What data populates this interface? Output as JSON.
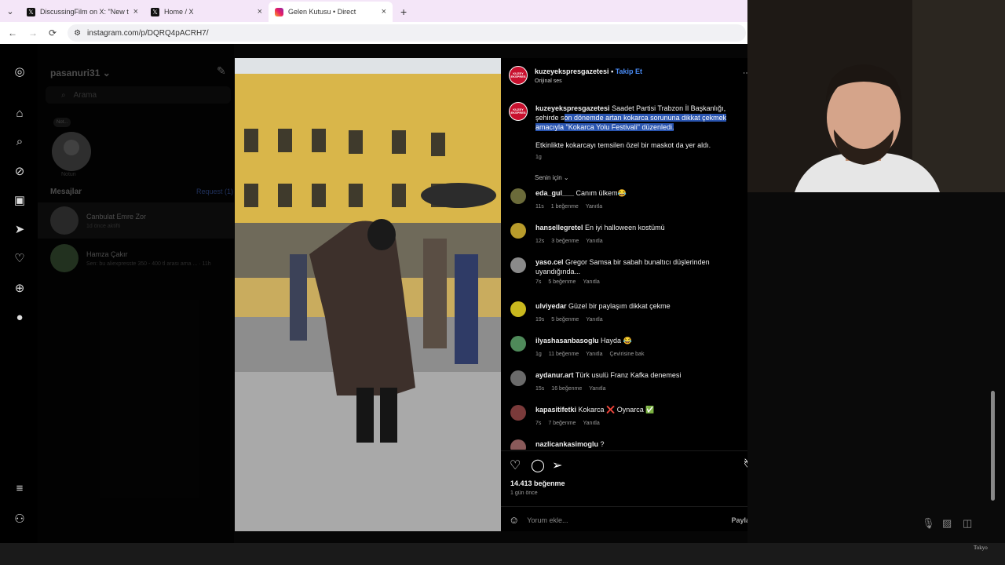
{
  "browser": {
    "tabs": [
      {
        "label": "DiscussingFilm on X: \"New trail",
        "icon": "x-logo-icon"
      },
      {
        "label": "Home / X",
        "icon": "x-logo-icon"
      },
      {
        "label": "Gelen Kutusu • Direct",
        "icon": "instagram-icon"
      }
    ],
    "url": "instagram.com/p/DQRQ4pACRH7/"
  },
  "dm": {
    "username": "pasanuri31",
    "search_placeholder": "Arama",
    "note_label": "Notun",
    "note_bubble": "Not...",
    "section_title": "Mesajlar",
    "requests": "Request (1)",
    "conversations": [
      {
        "name": "Canbulat Emre Zor",
        "sub": "1d önce aktifti"
      },
      {
        "name": "Hamza Çakır",
        "sub": "Sen: bu aliexpresste 350 - 400 tl arası ama ... · 11h"
      }
    ]
  },
  "post": {
    "account": "kuzeyekspresgazetesi",
    "follow": "Takip Et",
    "audio": "Orijinal ses",
    "logo_text": "KUZEY EKSPRES",
    "caption_lead": "Saadet Partisi Trabzon İl Başkanlığı, şehirde s",
    "caption_highlight": "on dönemde artan kokarca sorununa dikkat çekmek amacıyla \"Kokarca Yolu Festivali\" düzenledi.",
    "caption_second": "Etkinlikte kokarcayı temsilen özel bir maskot da yer aldı.",
    "caption_time": "1g",
    "sort_label": "Senin için",
    "media_watermark": "KUZEY EKSPRES",
    "likes": "14.413 beğenme",
    "posted_ago": "1 gün önce",
    "comment_placeholder": "Yorum ekle...",
    "share_label": "Paylaş"
  },
  "comments": [
    {
      "user": "eda_gul___",
      "text": "Canım ülkem😂",
      "time": "11s",
      "likes": "1 beğenme",
      "reply": "Yanıtla",
      "extra": "",
      "color": "#6b6b3a"
    },
    {
      "user": "hansellegretel",
      "text": "En iyi halloween kostümü",
      "time": "12s",
      "likes": "3 beğenme",
      "reply": "Yanıtla",
      "extra": "",
      "color": "#b89b2b"
    },
    {
      "user": "yaso.cel",
      "text": "Gregor Samsa bir sabah bunaltıcı düşlerinden uyandığında...",
      "time": "7s",
      "likes": "5 beğenme",
      "reply": "Yanıtla",
      "extra": "",
      "color": "#8a8a8a"
    },
    {
      "user": "ulviyedar",
      "text": "Güzel bir paylaşım dikkat çekme",
      "time": "19s",
      "likes": "5 beğenme",
      "reply": "Yanıtla",
      "extra": "",
      "color": "#c9b81e"
    },
    {
      "user": "ilyashasanbasoglu",
      "text": "Hayda 😂",
      "time": "1g",
      "likes": "11 beğenme",
      "reply": "Yanıtla",
      "extra": "Çevirisine bak",
      "color": "#4f8a5a"
    },
    {
      "user": "aydanur.art",
      "text": "Türk usulü Franz Kafka denemesi",
      "time": "15s",
      "likes": "16 beğenme",
      "reply": "Yanıtla",
      "extra": "",
      "color": "#6a6a6a"
    },
    {
      "user": "kapasitifetki",
      "text": "Kokarca ❌ Oynarca ✅",
      "time": "7s",
      "likes": "7 beğenme",
      "reply": "Yanıtla",
      "extra": "",
      "color": "#7a3a3a"
    },
    {
      "user": "nazlicankasimoglu",
      "text": "?",
      "time": "",
      "likes": "",
      "reply": "",
      "extra": "",
      "color": "#8a5a5a"
    }
  ],
  "taskbar": {
    "location": "Tokyo"
  }
}
